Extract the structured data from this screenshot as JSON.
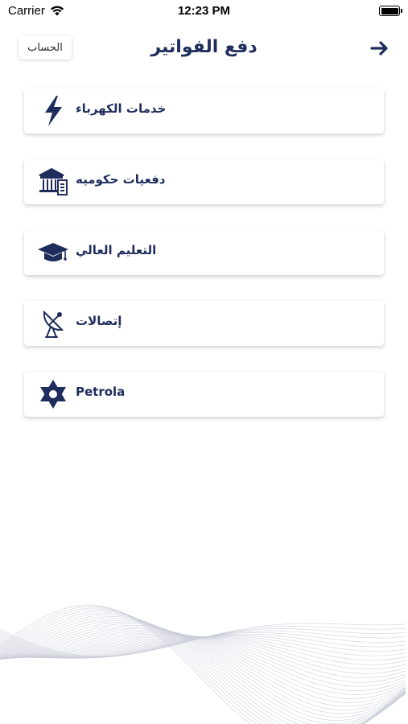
{
  "status_bar": {
    "carrier": "Carrier",
    "time": "12:23 PM"
  },
  "nav": {
    "title": "دفع الفواتير",
    "account_label": "الحساب"
  },
  "services": [
    {
      "label": "خدمات الكهرباء",
      "icon": "lightning-icon"
    },
    {
      "label": "دفعيات حكوميه",
      "icon": "government-building-icon"
    },
    {
      "label": "التعليم  العالي",
      "icon": "graduation-cap-icon"
    },
    {
      "label": "إتصالات",
      "icon": "satellite-dish-icon"
    },
    {
      "label": "Petrola",
      "icon": "petrola-star-icon"
    }
  ],
  "colors": {
    "primary": "#1f2d5c",
    "wave": "#c6cad6"
  }
}
